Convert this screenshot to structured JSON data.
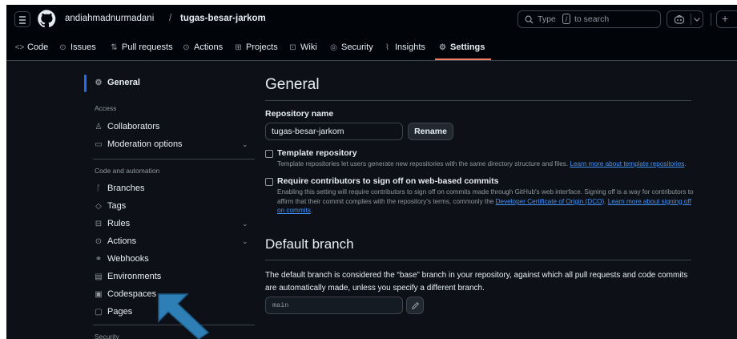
{
  "header": {
    "owner": "andiahmadnurmadani",
    "separator": "/",
    "repo": "tugas-besar-jarkom",
    "search_prefix": "Type",
    "search_key": "/",
    "search_suffix": "to search",
    "plus": "+"
  },
  "tabs": [
    {
      "label": "Code",
      "icon": "code-icon"
    },
    {
      "label": "Issues",
      "icon": "issue-icon"
    },
    {
      "label": "Pull requests",
      "icon": "pull-request-icon"
    },
    {
      "label": "Actions",
      "icon": "play-icon"
    },
    {
      "label": "Projects",
      "icon": "table-icon"
    },
    {
      "label": "Wiki",
      "icon": "book-icon"
    },
    {
      "label": "Security",
      "icon": "shield-icon"
    },
    {
      "label": "Insights",
      "icon": "graph-icon"
    },
    {
      "label": "Settings",
      "icon": "gear-icon",
      "active": true
    }
  ],
  "sidebar": {
    "general": "General",
    "access_heading": "Access",
    "collaborators": "Collaborators",
    "moderation": "Moderation options",
    "code_heading": "Code and automation",
    "branches": "Branches",
    "tags": "Tags",
    "rules": "Rules",
    "actions": "Actions",
    "webhooks": "Webhooks",
    "environments": "Environments",
    "codespaces": "Codespaces",
    "pages": "Pages",
    "security_heading": "Security"
  },
  "main": {
    "title": "General",
    "repo_name_label": "Repository name",
    "repo_name_value": "tugas-besar-jarkom",
    "rename_button": "Rename",
    "template": {
      "title": "Template repository",
      "desc": "Template repositories let users generate new repositories with the same directory structure and files.",
      "link": "Learn more about template repositories",
      "after": ".",
      "checked": false
    },
    "signoff": {
      "title": "Require contributors to sign off on web-based commits",
      "desc": "Enabling this setting will require contributors to sign off on commits made through GitHub's web interface. Signing off is a way for contributors to affirm that their commit complies with the repository's terms, commonly the",
      "link1": "Developer Certificate of Origin (DCO)",
      "mid": ".",
      "link2": "Learn more about signing off on commits",
      "after": ".",
      "checked": false
    },
    "default_branch": {
      "title": "Default branch",
      "desc": "The default branch is considered the “base” branch in your repository, against which all pull requests and code commits are automatically made, unless you specify a different branch.",
      "value": "main"
    }
  },
  "colors": {
    "background": "#0d1117",
    "header": "#010409",
    "accent": "#1f6feb",
    "tab_underline": "#f78166",
    "link": "#4493f8",
    "arrow": "#2e7fb5"
  }
}
